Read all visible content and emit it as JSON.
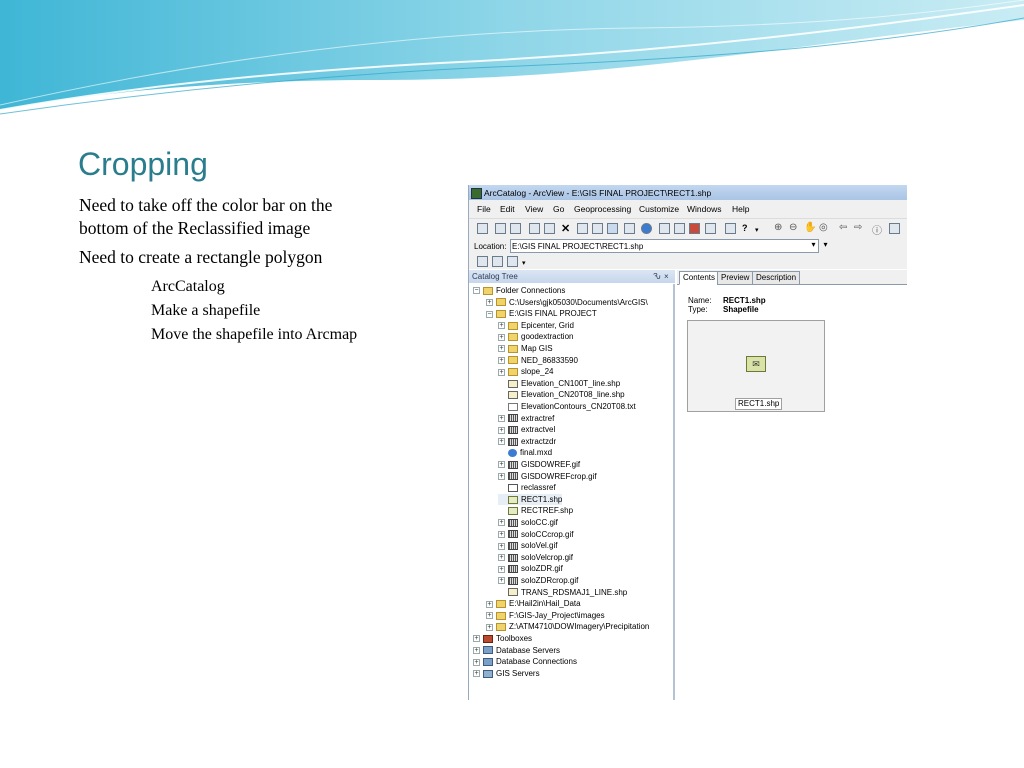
{
  "slide": {
    "title": "Cropping",
    "bullets": [
      "Need to take off the color bar on the bottom of the Reclassified image",
      "Need to create a  rectangle polygon"
    ],
    "subbullets": [
      "ArcCatalog",
      "Make a shapefile",
      "Move the shapefile into Arcmap"
    ]
  },
  "window": {
    "title": "ArcCatalog - ArcView - E:\\GIS FINAL PROJECT\\RECT1.shp",
    "menu": [
      "File",
      "Edit",
      "View",
      "Go",
      "Geoprocessing",
      "Customize",
      "Windows",
      "Help"
    ],
    "location_label": "Location:",
    "location_value": "E:\\GIS FINAL PROJECT\\RECT1.shp"
  },
  "catalog": {
    "title": "Catalog Tree",
    "pin": "Ԅ",
    "close": "×",
    "items": [
      {
        "label": "Folder Connections",
        "level": 0,
        "icon": "folder",
        "exp": "−"
      },
      {
        "label": "C:\\Users\\gjk05030\\Documents\\ArcGIS\\",
        "level": 1,
        "icon": "folder",
        "exp": "+"
      },
      {
        "label": "E:\\GIS FINAL PROJECT",
        "level": 1,
        "icon": "folder",
        "exp": "−"
      },
      {
        "label": "Epicenter, Grid",
        "level": 2,
        "icon": "folder",
        "exp": "+"
      },
      {
        "label": "goodextraction",
        "level": 2,
        "icon": "folder",
        "exp": "+"
      },
      {
        "label": "Map GIS",
        "level": 2,
        "icon": "folder",
        "exp": "+"
      },
      {
        "label": "NED_86833590",
        "level": 2,
        "icon": "folder",
        "exp": "+"
      },
      {
        "label": "slope_24",
        "level": 2,
        "icon": "folder",
        "exp": "+"
      },
      {
        "label": "Elevation_CN100T_line.shp",
        "level": 2,
        "icon": "line",
        "exp": ""
      },
      {
        "label": "Elevation_CN20T08_line.shp",
        "level": 2,
        "icon": "line",
        "exp": ""
      },
      {
        "label": "ElevationContours_CN20T08.txt",
        "level": 2,
        "icon": "txtf",
        "exp": ""
      },
      {
        "label": "extractref",
        "level": 2,
        "icon": "raster",
        "exp": "+"
      },
      {
        "label": "extractvel",
        "level": 2,
        "icon": "raster",
        "exp": "+"
      },
      {
        "label": "extractzdr",
        "level": 2,
        "icon": "raster",
        "exp": "+"
      },
      {
        "label": "final.mxd",
        "level": 2,
        "icon": "mxd",
        "exp": ""
      },
      {
        "label": "GISDOWREF.gif",
        "level": 2,
        "icon": "raster",
        "exp": "+"
      },
      {
        "label": "GISDOWREFcrop.gif",
        "level": 2,
        "icon": "raster",
        "exp": "+"
      },
      {
        "label": "reclassref",
        "level": 2,
        "icon": "table",
        "exp": ""
      },
      {
        "label": "RECT1.shp",
        "level": 2,
        "icon": "poly",
        "exp": "",
        "selected": true
      },
      {
        "label": "RECTREF.shp",
        "level": 2,
        "icon": "poly",
        "exp": ""
      },
      {
        "label": "soloCC.gif",
        "level": 2,
        "icon": "raster",
        "exp": "+"
      },
      {
        "label": "soloCCcrop.gif",
        "level": 2,
        "icon": "raster",
        "exp": "+"
      },
      {
        "label": "soloVel.gif",
        "level": 2,
        "icon": "raster",
        "exp": "+"
      },
      {
        "label": "soloVelcrop.gif",
        "level": 2,
        "icon": "raster",
        "exp": "+"
      },
      {
        "label": "soloZDR.gif",
        "level": 2,
        "icon": "raster",
        "exp": "+"
      },
      {
        "label": "soloZDRcrop.gif",
        "level": 2,
        "icon": "raster",
        "exp": "+"
      },
      {
        "label": "TRANS_RDSMAJ1_LINE.shp",
        "level": 2,
        "icon": "line",
        "exp": ""
      },
      {
        "label": "E:\\Hail2in\\Hail_Data",
        "level": 1,
        "icon": "folder",
        "exp": "+"
      },
      {
        "label": "F:\\GIS-Jay_Project\\images",
        "level": 1,
        "icon": "folder",
        "exp": "+"
      },
      {
        "label": "Z:\\ATM4710\\DOWImagery\\Precipitation",
        "level": 1,
        "icon": "folder",
        "exp": "+"
      },
      {
        "label": "Toolboxes",
        "level": 0,
        "icon": "redbox",
        "exp": "+"
      },
      {
        "label": "Database Servers",
        "level": 0,
        "icon": "db",
        "exp": "+"
      },
      {
        "label": "Database Connections",
        "level": 0,
        "icon": "db",
        "exp": "+"
      },
      {
        "label": "GIS Servers",
        "level": 0,
        "icon": "gis",
        "exp": "+"
      }
    ]
  },
  "contents": {
    "tabs": [
      "Contents",
      "Preview",
      "Description"
    ],
    "name_label": "Name:",
    "name_value": "RECT1.shp",
    "type_label": "Type:",
    "type_value": "Shapefile",
    "thumb_label": "RECT1.shp"
  }
}
